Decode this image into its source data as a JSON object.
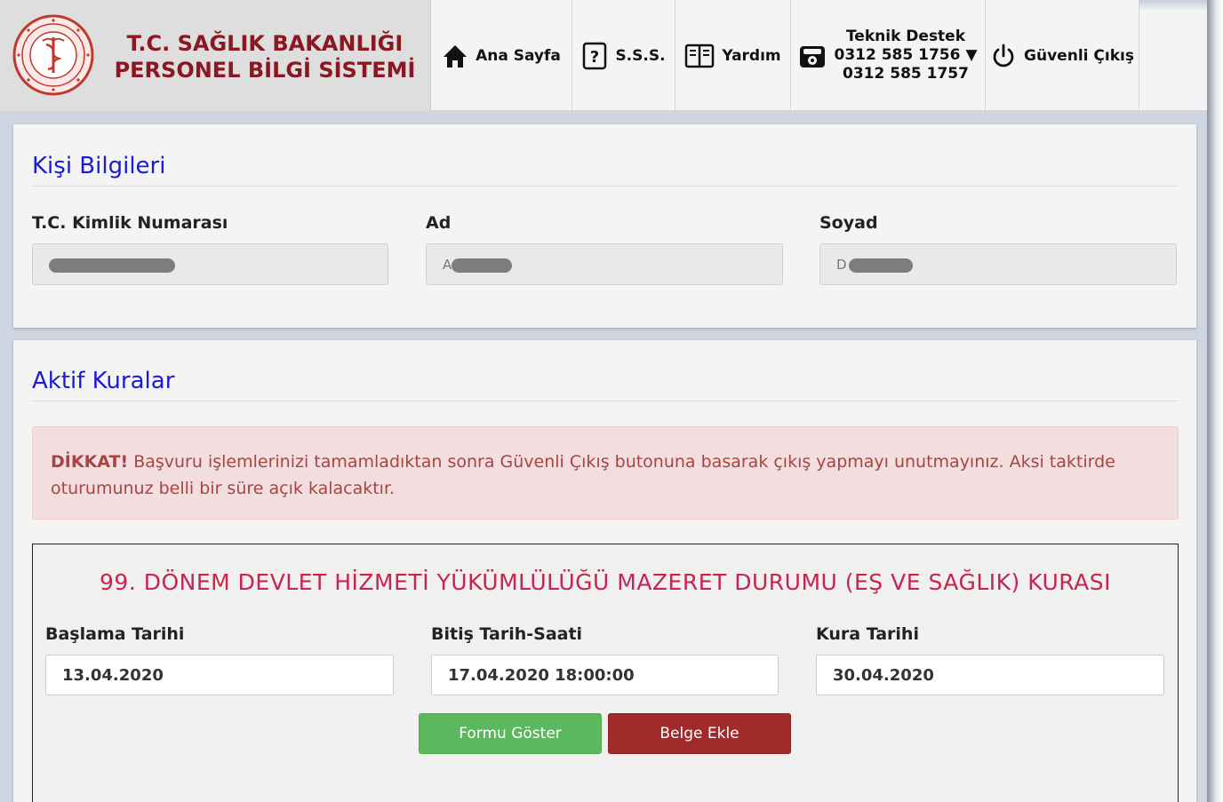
{
  "brand": {
    "line1": "T.C. SAĞLIK BAKANLIĞI",
    "line2": "PERSONEL BİLGİ SİSTEMİ",
    "logo_icon": "ministry-seal-icon",
    "color": "#8b1820"
  },
  "nav": {
    "home_label": "Ana Sayfa",
    "faq_label": "S.S.S.",
    "help_label": "Yardım",
    "support_title": "Teknik Destek",
    "support_phone1": "0312 585 1756",
    "support_phone2": "0312 585 1757",
    "logout_label": "Güvenli Çıkış",
    "icons": [
      "home-icon",
      "question-icon",
      "book-icon",
      "phone-icon",
      "power-icon"
    ]
  },
  "person": {
    "section_title": "Kişi Bilgileri",
    "tc_label": "T.C. Kimlik Numarası",
    "tc_value": "",
    "ad_label": "Ad",
    "ad_value": "A",
    "soyad_label": "Soyad",
    "soyad_value": "D"
  },
  "rules": {
    "section_title": "Aktif Kuralar",
    "alert_strong": "DİKKAT!",
    "alert_text": " Başvuru işlemlerinizi tamamladıktan sonra Güvenli Çıkış butonuna basarak çıkış yapmayı unutmayınız. Aksi taktirde oturumunuz belli bir süre açık kalacaktır.",
    "kura": {
      "title": "99. DÖNEM DEVLET HİZMETİ YÜKÜMLÜLÜĞÜ MAZERET DURUMU (EŞ VE SAĞLIK) KURASI",
      "start_label": "Başlama Tarihi",
      "start_value": "13.04.2020",
      "end_label": "Bitiş Tarih-Saati",
      "end_value": "17.04.2020 18:00:00",
      "draw_label": "Kura Tarihi",
      "draw_value": "30.04.2020",
      "show_form_label": "Formu Göster",
      "add_doc_label": "Belge Ekle"
    }
  },
  "colors": {
    "section_title": "#1a1ad9",
    "kura_title": "#c7254e",
    "green_button": "#5cb85c",
    "red_button": "#a12a2a",
    "alert_bg": "#f2dede"
  }
}
